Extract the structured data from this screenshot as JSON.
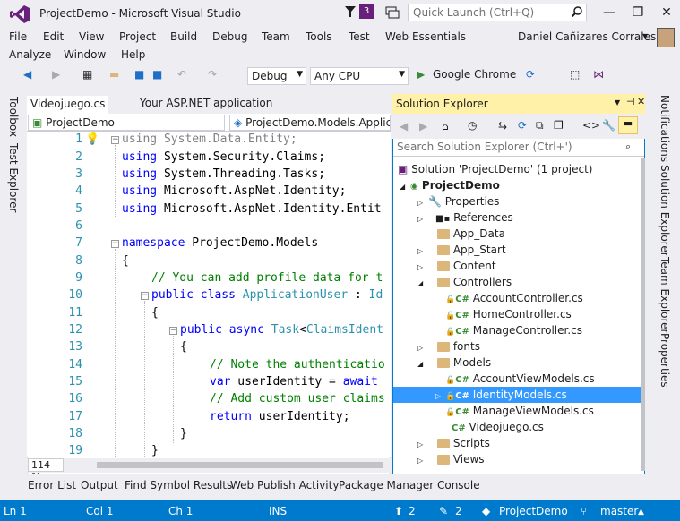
{
  "window": {
    "title": "ProjectDemo - Microsoft Visual Studio",
    "quick_launch_placeholder": "Quick Launch (Ctrl+Q)",
    "notification_count": "3"
  },
  "menu": {
    "row1": [
      "File",
      "Edit",
      "View",
      "Project",
      "Build",
      "Debug",
      "Team",
      "Tools",
      "Test",
      "Web Essentials"
    ],
    "row2": [
      "Analyze",
      "Window",
      "Help"
    ],
    "user": "Daniel Cañizares Corrales"
  },
  "toolbar": {
    "config": "Debug",
    "platform": "Any CPU",
    "run_target": "Google Chrome"
  },
  "left_strip": [
    "Toolbox",
    "Test Explorer"
  ],
  "right_strip": [
    "Notifications",
    "Solution Explorer",
    "Team Explorer",
    "Properties"
  ],
  "editor": {
    "tabs": [
      "Videojuego.cs",
      "Your ASP.NET application"
    ],
    "nav_left": "ProjectDemo",
    "nav_right": "ProjectDemo.Models.Applic",
    "line_numbers": [
      "1",
      "2",
      "3",
      "4",
      "5",
      "6",
      "7",
      "8",
      "9",
      "10",
      "11",
      "12",
      "13",
      "14",
      "15",
      "16",
      "17",
      "18",
      "19"
    ],
    "zoom": "114 %"
  },
  "solution_explorer": {
    "title": "Solution Explorer",
    "search_placeholder": "Search Solution Explorer (Ctrl+')",
    "solution": "Solution 'ProjectDemo' (1 project)",
    "project": "ProjectDemo",
    "items": [
      "Properties",
      "References",
      "App_Data",
      "App_Start",
      "Content",
      "Controllers",
      "AccountController.cs",
      "HomeController.cs",
      "ManageController.cs",
      "fonts",
      "Models",
      "AccountViewModels.cs",
      "IdentityModels.cs",
      "ManageViewModels.cs",
      "Videojuego.cs",
      "Scripts",
      "Views"
    ]
  },
  "bottom_tabs": [
    "Error List",
    "Output",
    "Find Symbol Results",
    "Web Publish Activity",
    "Package Manager Console"
  ],
  "status": {
    "ln": "Ln 1",
    "col": "Col 1",
    "ch": "Ch 1",
    "ins": "INS",
    "up": "2",
    "pen": "2",
    "repo": "ProjectDemo",
    "branch": "master"
  },
  "colors": {
    "accent": "#007acc",
    "se_title_bg": "#fff1a8",
    "selection": "#3399ff"
  }
}
